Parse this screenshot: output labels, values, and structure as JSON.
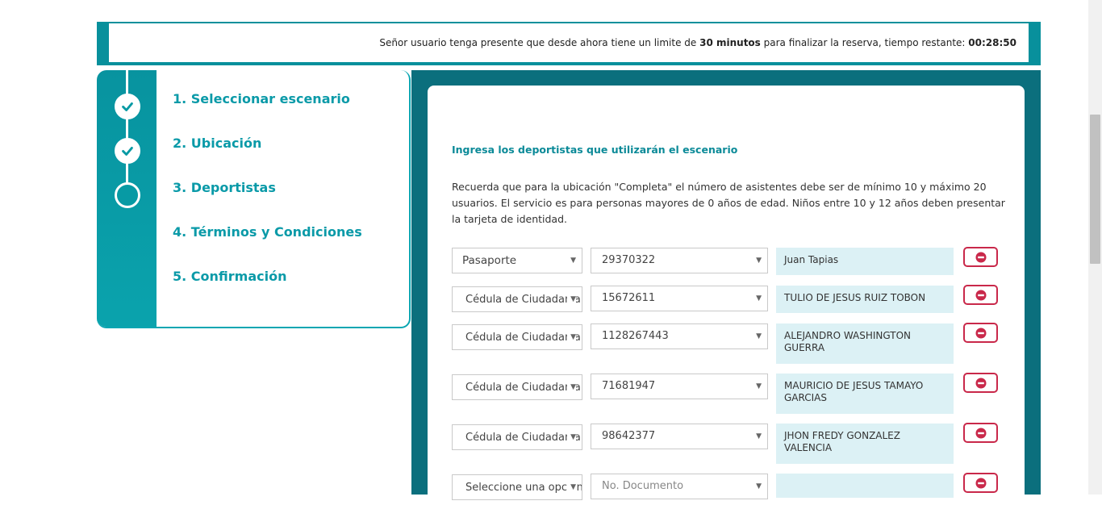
{
  "timer": {
    "prefix": "Señor usuario tenga presente que desde ahora tiene un limite de ",
    "limit": "30 minutos",
    "middle": " para finalizar la reserva, tiempo restante: ",
    "remaining": "00:28:50"
  },
  "steps": [
    {
      "label": "1. Seleccionar escenario",
      "status": "done"
    },
    {
      "label": "2. Ubicación",
      "status": "done"
    },
    {
      "label": "3. Deportistas",
      "status": "current"
    },
    {
      "label": "4. Términos y Condiciones",
      "status": "pending"
    },
    {
      "label": "5. Confirmación",
      "status": "pending"
    }
  ],
  "form": {
    "title": "Ingresa los deportistas que utilizarán el escenario",
    "description": "Recuerda que para la ubicación \"Completa\" el número de asistentes debe ser de mínimo 10 y máximo 20 usuarios. El servicio es para personas mayores de 0 años de edad. Niños entre 10 y 12 años deben presentar la tarjeta de identidad.",
    "rows": [
      {
        "doc_type": "Pasaporte",
        "doc_number": "29370322",
        "name": "Juan Tapias"
      },
      {
        "doc_type": "Cédula de Ciudadanía",
        "doc_number": "15672611",
        "name": "TULIO DE JESUS RUIZ TOBON"
      },
      {
        "doc_type": "Cédula de Ciudadanía",
        "doc_number": "1128267443",
        "name": "ALEJANDRO WASHINGTON GUERRA"
      },
      {
        "doc_type": "Cédula de Ciudadanía",
        "doc_number": "71681947",
        "name": "MAURICIO DE JESUS TAMAYO GARCIAS"
      },
      {
        "doc_type": "Cédula de Ciudadanía",
        "doc_number": "98642377",
        "name": "JHON FREDY GONZALEZ VALENCIA"
      },
      {
        "doc_type": "Seleccione una opción",
        "doc_number": "No. Documento",
        "name": ""
      }
    ]
  },
  "colors": {
    "accent": "#0a9aa8",
    "panel": "#0b6f7d",
    "remove": "#c9284a",
    "name_bg": "#dcf1f5"
  },
  "icons": {
    "done": "check-icon",
    "remove": "minus-circle-icon"
  }
}
